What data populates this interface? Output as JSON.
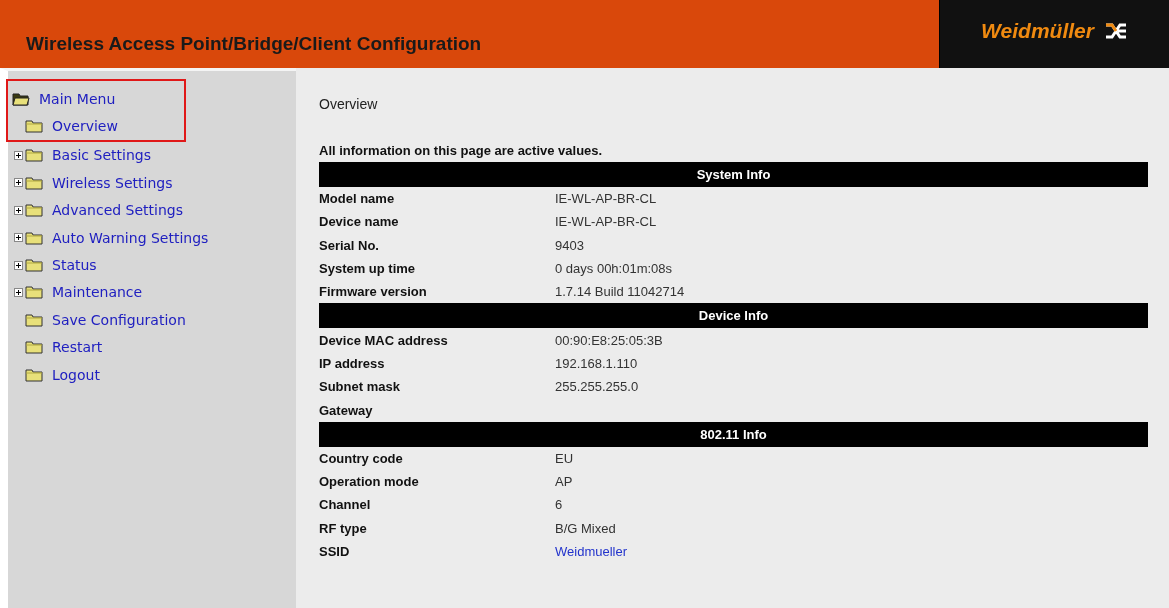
{
  "header": {
    "title": "Wireless Access Point/Bridge/Client Configuration",
    "logo": "Weidmüller"
  },
  "menu": {
    "label": "Main Menu",
    "expanded": true,
    "highlighted": true,
    "children": [
      {
        "label": "Overview",
        "expandable": false
      },
      {
        "label": "Basic Settings",
        "expandable": true
      },
      {
        "label": "Wireless Settings",
        "expandable": true
      },
      {
        "label": "Advanced Settings",
        "expandable": true
      },
      {
        "label": "Auto Warning Settings",
        "expandable": true
      },
      {
        "label": "Status",
        "expandable": true
      },
      {
        "label": "Maintenance",
        "expandable": true
      },
      {
        "label": "Save Configuration",
        "expandable": false
      },
      {
        "label": "Restart",
        "expandable": false
      },
      {
        "label": "Logout",
        "expandable": false
      }
    ]
  },
  "page": {
    "title": "Overview",
    "note": "All information on this page are active values.",
    "rows": [
      {
        "kind": "header",
        "label": "System Info"
      },
      {
        "kind": "row",
        "label": "Model name",
        "value": "IE-WL-AP-BR-CL"
      },
      {
        "kind": "row",
        "label": "Device name",
        "value": "IE-WL-AP-BR-CL"
      },
      {
        "kind": "row",
        "label": "Serial No.",
        "value": "9403"
      },
      {
        "kind": "row",
        "label": "System up time",
        "value": "0 days 00h:01m:08s"
      },
      {
        "kind": "row",
        "label": "Firmware version",
        "value": "1.7.14 Build 11042714"
      },
      {
        "kind": "header",
        "label": "Device Info"
      },
      {
        "kind": "row",
        "label": "Device MAC address",
        "value": "00:90:E8:25:05:3B"
      },
      {
        "kind": "row",
        "label": "IP address",
        "value": "192.168.1.110"
      },
      {
        "kind": "row",
        "label": "Subnet mask",
        "value": "255.255.255.0"
      },
      {
        "kind": "row",
        "label": "Gateway"
      },
      {
        "kind": "header",
        "label": "802.11 Info"
      },
      {
        "kind": "row",
        "label": "Country code",
        "value": "EU"
      },
      {
        "kind": "row",
        "label": "Operation mode",
        "value": "AP"
      },
      {
        "kind": "row",
        "label": "Channel",
        "value": "6"
      },
      {
        "kind": "row",
        "label": "RF type",
        "value": "B/G Mixed"
      },
      {
        "kind": "link",
        "label": "SSID",
        "value": "Weidmueller"
      }
    ]
  }
}
